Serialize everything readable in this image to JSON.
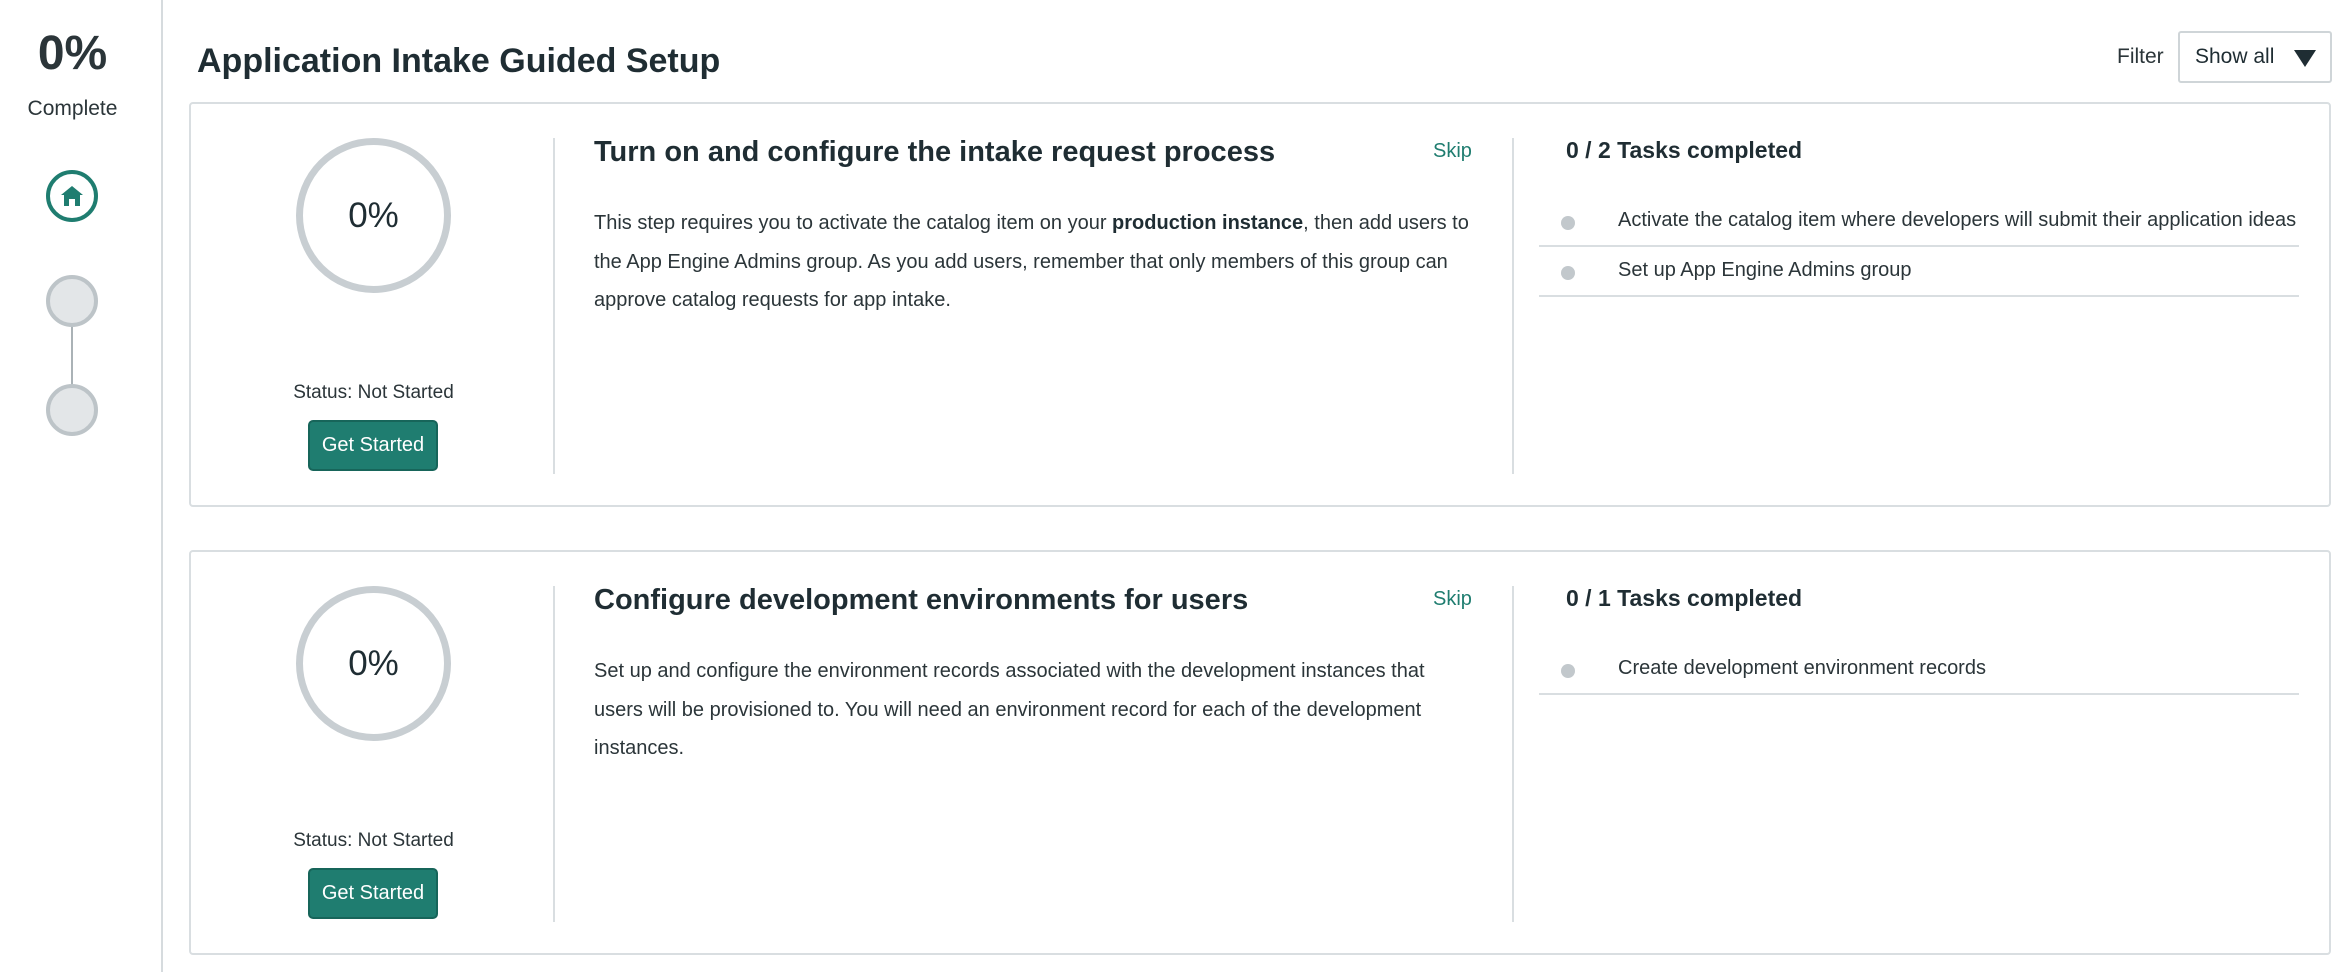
{
  "overall": {
    "percent": "0%",
    "label": "Complete"
  },
  "header": {
    "title": "Application Intake Guided Setup"
  },
  "filter": {
    "label": "Filter",
    "value": "Show all"
  },
  "steps": [
    {
      "percent": "0%",
      "status": "Status: Not Started",
      "button": "Get Started",
      "title": "Turn on and configure the intake request process",
      "skip": "Skip",
      "description": {
        "before": "This step requires you to activate the catalog item on your ",
        "bold": "production instance",
        "after": ", then add users to the App Engine Admins group. As you add users, remember that only members of this group can approve catalog requests for app intake."
      },
      "tasks_heading": "0 / 2 Tasks completed",
      "tasks": [
        "Activate the catalog item where developers will submit their application ideas",
        "Set up App Engine Admins group"
      ]
    },
    {
      "percent": "0%",
      "status": "Status: Not Started",
      "button": "Get Started",
      "title": "Configure development environments for users",
      "skip": "Skip",
      "description": {
        "before": "Set up and configure the environment records associated with the development instances that users will be provisioned to. You will need an environment record for each of the development instances.",
        "bold": "",
        "after": ""
      },
      "tasks_heading": "0 / 1 Tasks completed",
      "tasks": [
        "Create development environment records"
      ]
    }
  ],
  "colors": {
    "accent": "#1f7d70",
    "ring": "#c8ced2",
    "border": "#d9dee1"
  },
  "icons": {
    "home": "home-icon",
    "filter_caret": "caret-down-icon"
  }
}
